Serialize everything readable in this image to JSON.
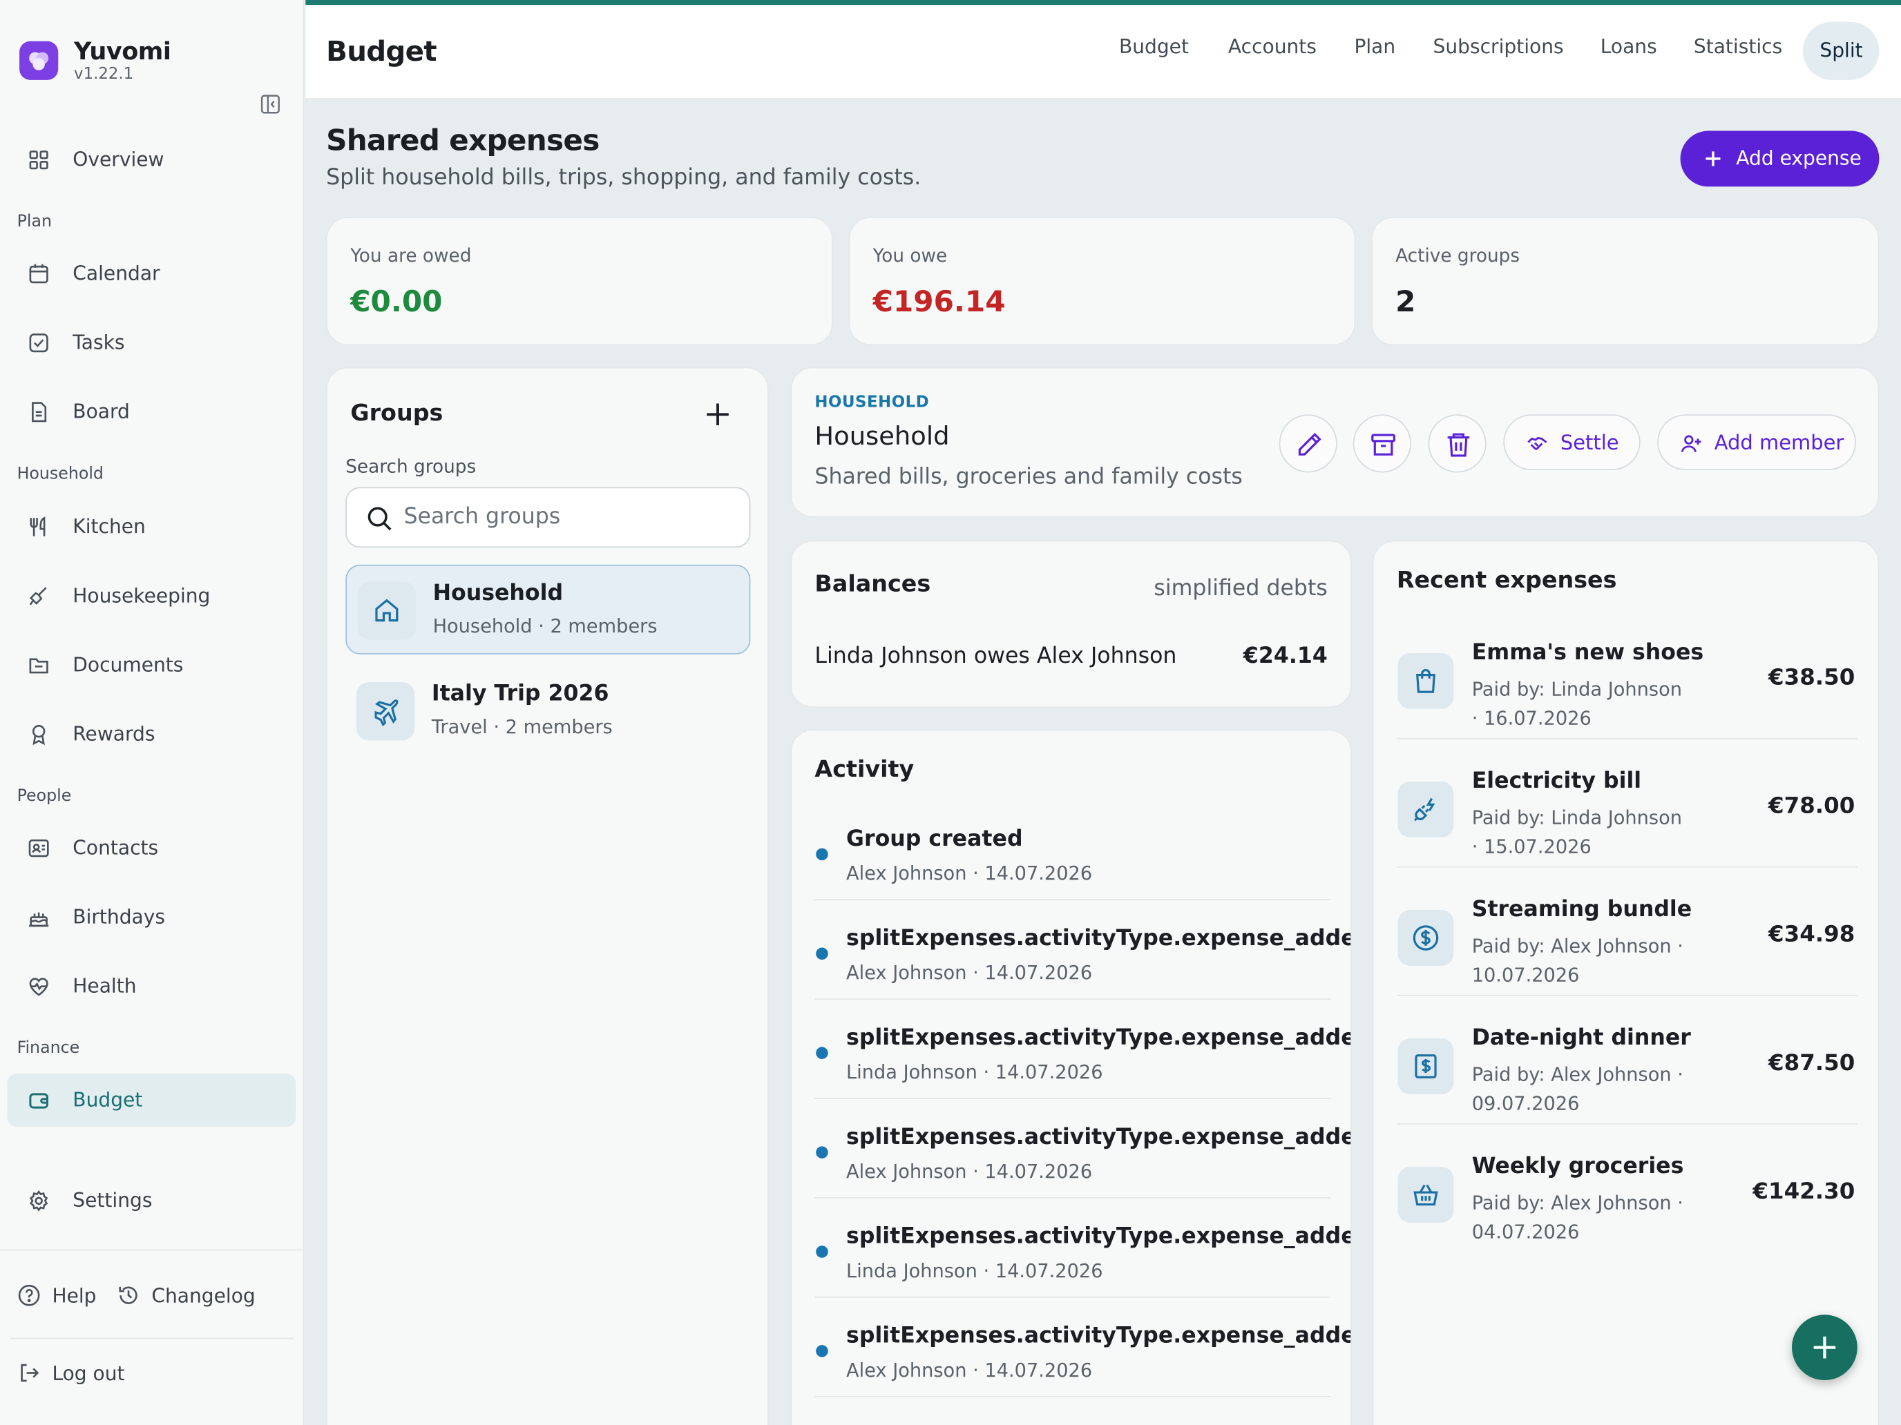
{
  "app": {
    "name": "Yuvomi",
    "version": "v1.22.1"
  },
  "sidebar": {
    "overview": "Overview",
    "sections": {
      "plan": "Plan",
      "household": "Household",
      "people": "People",
      "finance": "Finance"
    },
    "items": [
      {
        "label": "Calendar",
        "icon": "calendar-icon"
      },
      {
        "label": "Tasks",
        "icon": "check-square-icon"
      },
      {
        "label": "Board",
        "icon": "note-icon"
      },
      {
        "label": "Kitchen",
        "icon": "utensils-icon"
      },
      {
        "label": "Housekeeping",
        "icon": "brush-icon"
      },
      {
        "label": "Documents",
        "icon": "folder-icon"
      },
      {
        "label": "Rewards",
        "icon": "award-icon"
      },
      {
        "label": "Contacts",
        "icon": "contact-card-icon"
      },
      {
        "label": "Birthdays",
        "icon": "cake-icon"
      },
      {
        "label": "Health",
        "icon": "heart-pulse-icon"
      },
      {
        "label": "Budget",
        "icon": "wallet-icon"
      }
    ],
    "settings": "Settings",
    "help": "Help",
    "changelog": "Changelog",
    "logout": "Log out"
  },
  "topbar": {
    "title": "Budget",
    "tabs": [
      "Budget",
      "Accounts",
      "Plan",
      "Subscriptions",
      "Loans",
      "Statistics",
      "Split"
    ],
    "active_tab": "Split"
  },
  "header": {
    "title": "Shared expenses",
    "subtitle": "Split household bills, trips, shopping, and family costs.",
    "add_button": "Add expense"
  },
  "stats": [
    {
      "label": "You are owed",
      "value": "€0.00",
      "color": "#1e8a3e"
    },
    {
      "label": "You owe",
      "value": "€196.14",
      "color": "#c42424"
    },
    {
      "label": "Active groups",
      "value": "2",
      "color": "#1b1f24"
    }
  ],
  "groups": {
    "title": "Groups",
    "search_label": "Search groups",
    "search_placeholder": "Search groups",
    "items": [
      {
        "name": "Household",
        "meta": "Household · 2 members",
        "icon": "home-icon",
        "selected": true
      },
      {
        "name": "Italy Trip 2026",
        "meta": "Travel · 2 members",
        "icon": "plane-icon",
        "selected": false
      }
    ]
  },
  "group_detail": {
    "tag": "HOUSEHOLD",
    "title": "Household",
    "subtitle": "Shared bills, groceries and family costs",
    "settle": "Settle",
    "add_member": "Add member"
  },
  "balances": {
    "title": "Balances",
    "tag": "simplified debts",
    "items": [
      {
        "text": "Linda Johnson owes Alex Johnson",
        "amount": "€24.14"
      }
    ]
  },
  "activity": {
    "title": "Activity",
    "items": [
      {
        "title": "Group created",
        "meta": "Alex Johnson · 14.07.2026"
      },
      {
        "title": "splitExpenses.activityType.expense_added",
        "meta": "Alex Johnson · 14.07.2026"
      },
      {
        "title": "splitExpenses.activityType.expense_added",
        "meta": "Linda Johnson · 14.07.2026"
      },
      {
        "title": "splitExpenses.activityType.expense_added",
        "meta": "Alex Johnson · 14.07.2026"
      },
      {
        "title": "splitExpenses.activityType.expense_added",
        "meta": "Linda Johnson · 14.07.2026"
      },
      {
        "title": "splitExpenses.activityType.expense_added",
        "meta": "Alex Johnson · 14.07.2026"
      }
    ]
  },
  "recent": {
    "title": "Recent expenses",
    "items": [
      {
        "name": "Emma's new shoes",
        "paid": "Paid by: Linda Johnson · 16.07.2026",
        "amount": "€38.50",
        "icon": "shopping-bag-icon"
      },
      {
        "name": "Electricity bill",
        "paid": "Paid by: Linda Johnson · 15.07.2026",
        "amount": "€78.00",
        "icon": "plug-icon"
      },
      {
        "name": "Streaming bundle",
        "paid": "Paid by: Alex Johnson · 10.07.2026",
        "amount": "€34.98",
        "icon": "dollar-circle-icon"
      },
      {
        "name": "Date-night dinner",
        "paid": "Paid by: Alex Johnson · 09.07.2026",
        "amount": "€87.50",
        "icon": "receipt-icon"
      },
      {
        "name": "Weekly groceries",
        "paid": "Paid by: Alex Johnson · 04.07.2026",
        "amount": "€142.30",
        "icon": "basket-icon"
      }
    ]
  }
}
